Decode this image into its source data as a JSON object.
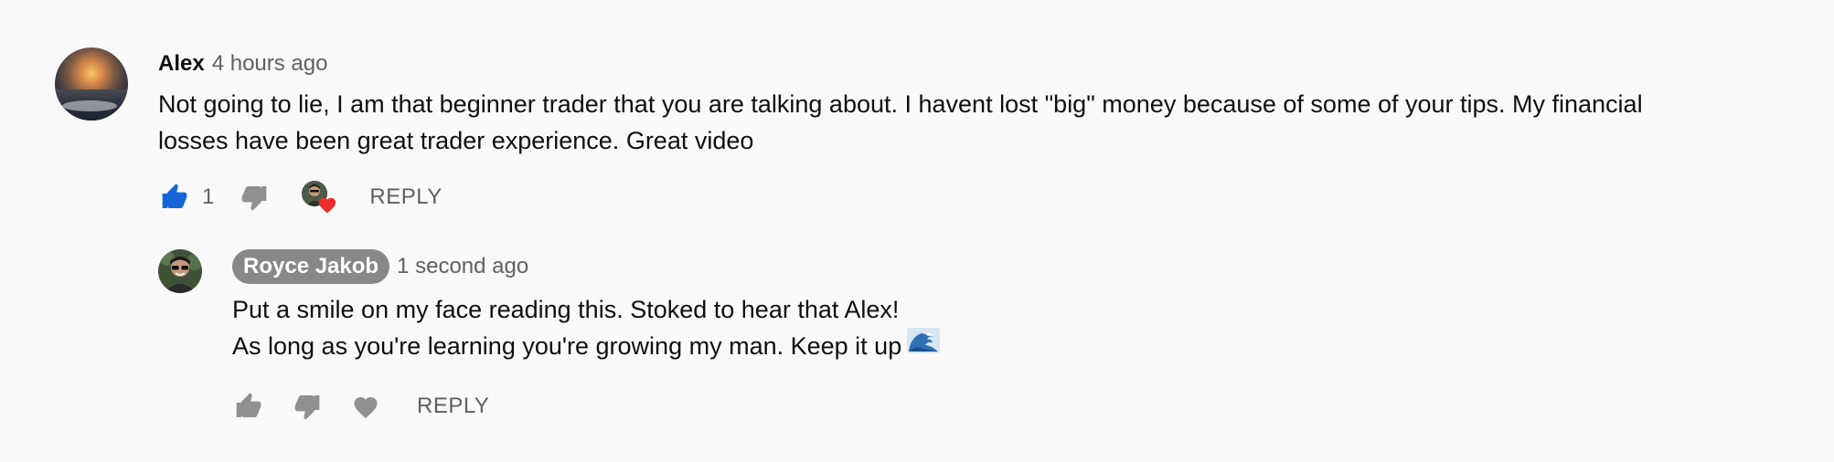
{
  "comment": {
    "author": "Alex",
    "time": "4 hours ago",
    "text_line1": "Not going to lie, I am that beginner trader that you are talking about. I havent lost \"big\" money because of some of your tips. My financial",
    "text_line2": "losses have been great trader experience. Great video",
    "like_count": "1",
    "reply_label": "REPLY",
    "liked": true,
    "hearted_by_creator": true
  },
  "reply": {
    "author": "Royce Jakob",
    "time": "1 second ago",
    "text_line1": "Put a smile on my face reading this. Stoked to hear that Alex!",
    "text_line2": "As long as you're learning you're growing my man. Keep it up",
    "emoji": "water-wave",
    "reply_label": "REPLY"
  },
  "colors": {
    "background": "#f9f9f9",
    "liked_blue": "#1565d8",
    "heart_red": "#ef2b2b",
    "icon_gray": "#909090",
    "secondary_text": "#606060",
    "author_badge_bg": "#888888"
  },
  "icons": [
    "thumbs-up-icon",
    "thumbs-down-icon",
    "heart-icon",
    "hearted-badge-icon",
    "wave-emoji-icon"
  ]
}
